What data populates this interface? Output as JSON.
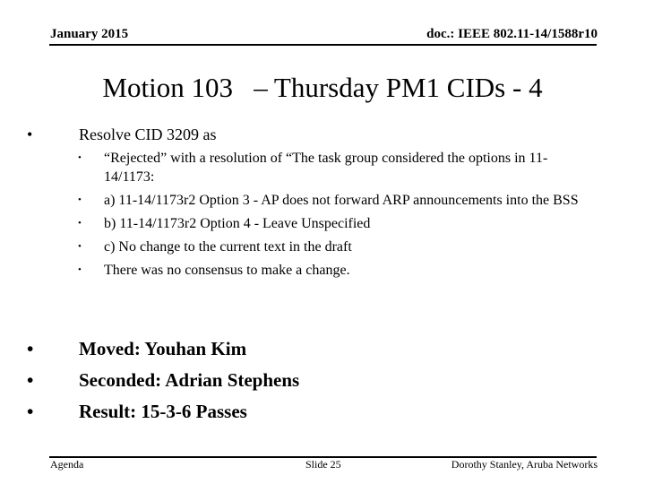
{
  "header": {
    "date": "January 2015",
    "doc_id": "doc.: IEEE 802.11-14/1588r10"
  },
  "title": "Motion 103   – Thursday PM1 CIDs - 4",
  "main_bullet": {
    "bullet": "•",
    "text": "Resolve CID 3209 as"
  },
  "sub_bullets": [
    {
      "bullet": "•",
      "text": "“Rejected” with a resolution of “The task group considered the options in 11-14/1173:"
    },
    {
      "bullet": "•",
      "text": "a) 11-14/1173r2 Option 3 - AP does not forward ARP announcements into the BSS"
    },
    {
      "bullet": "•",
      "text": "b) 11-14/1173r2 Option 4 - Leave Unspecified"
    },
    {
      "bullet": "•",
      "text": "c) No change to the current text in the draft"
    },
    {
      "bullet": "•",
      "text": "There was no consensus to make a change."
    }
  ],
  "motion_results": [
    {
      "bullet": "•",
      "text": "Moved: Youhan Kim"
    },
    {
      "bullet": "•",
      "text": "Seconded: Adrian Stephens"
    },
    {
      "bullet": "•",
      "text": "Result: 15-3-6 Passes"
    }
  ],
  "footer": {
    "left": "Agenda",
    "center": "Slide 25",
    "right": "Dorothy Stanley, Aruba Networks"
  }
}
